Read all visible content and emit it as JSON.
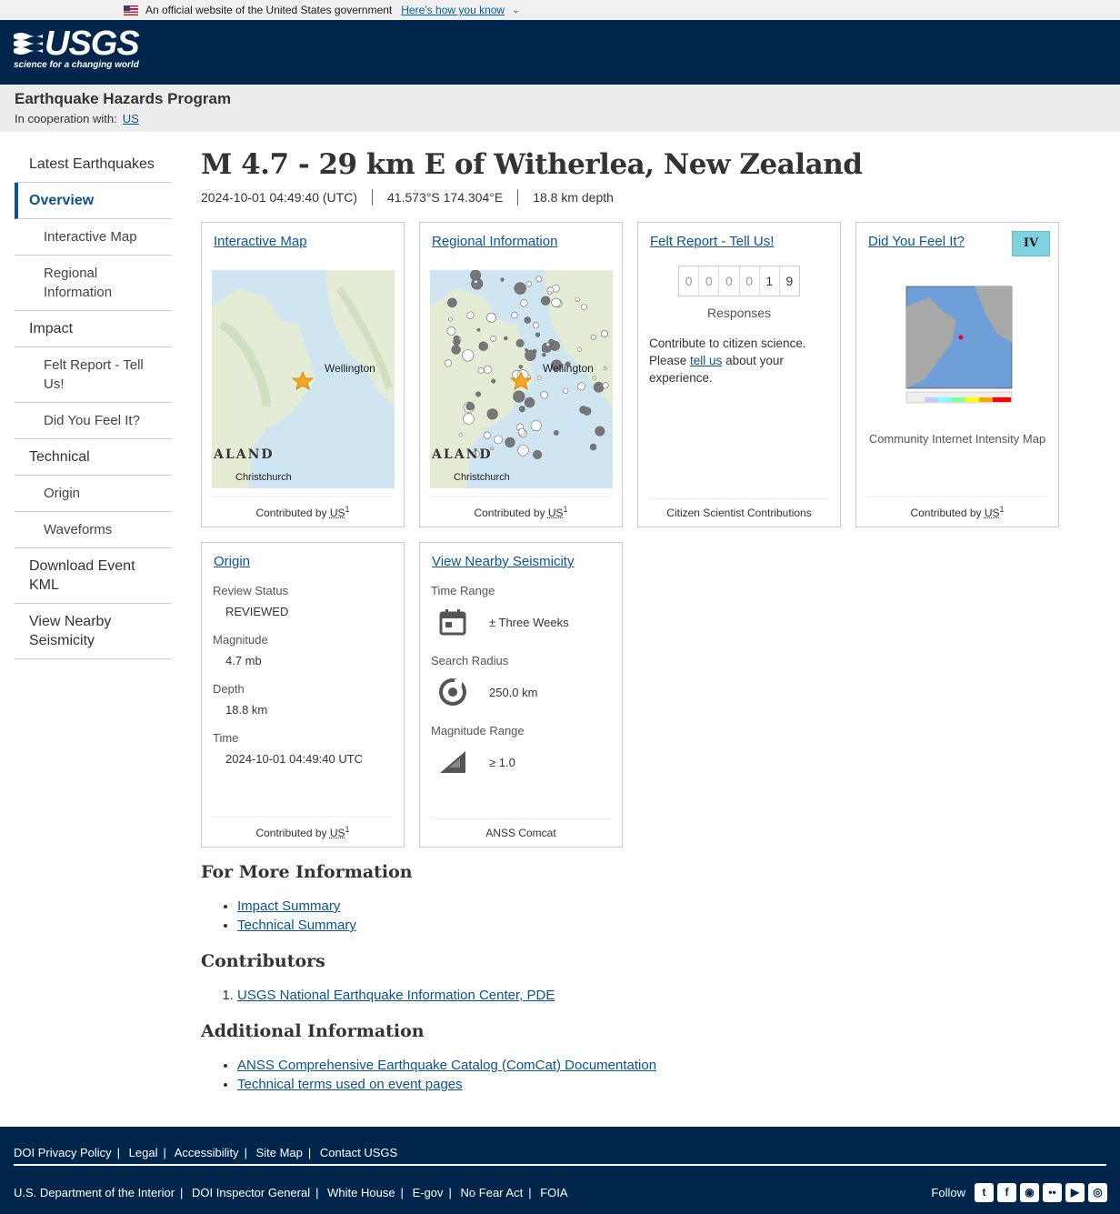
{
  "gov_banner": {
    "text": "An official website of the United States government",
    "link": "Here’s how you know"
  },
  "header": {
    "logo_text": "USGS",
    "logo_tagline": "science for a changing world"
  },
  "site": {
    "title": "Earthquake Hazards Program",
    "coop_label": "In cooperation with:",
    "coop_link": "US"
  },
  "sidebar": {
    "items": [
      {
        "label": "Latest Earthquakes"
      },
      {
        "label": "Overview"
      },
      {
        "label": "Interactive Map"
      },
      {
        "label": "Regional Information"
      },
      {
        "label": "Impact"
      },
      {
        "label": "Felt Report - Tell Us!"
      },
      {
        "label": "Did You Feel It?"
      },
      {
        "label": "Technical"
      },
      {
        "label": "Origin"
      },
      {
        "label": "Waveforms"
      },
      {
        "label": "Download Event KML"
      },
      {
        "label": "View Nearby Seismicity"
      }
    ]
  },
  "event": {
    "title": "M 4.7 - 29 km E of Witherlea, New Zealand",
    "time": "2024-10-01 04:49:40 (UTC)",
    "location": "41.573°S 174.304°E",
    "depth": "18.8 km depth"
  },
  "cards": {
    "interactive_map": {
      "title": "Interactive Map",
      "contributed": "Contributed by",
      "source": "US",
      "ref": "1",
      "place1": "Wellington",
      "place2": "ALAND",
      "place3": "Christchurch"
    },
    "regional": {
      "title": "Regional Information",
      "contributed": "Contributed by",
      "source": "US",
      "ref": "1",
      "place1": "Wellington",
      "place2": "ALAND",
      "place3": "Christchurch"
    },
    "felt": {
      "title": "Felt Report - Tell Us!",
      "digits": [
        "0",
        "0",
        "0",
        "0",
        "1",
        "9"
      ],
      "responses_label": "Responses",
      "text1": "Contribute to citizen science.",
      "text2": "Please",
      "link": "tell us",
      "text3": "about your experience.",
      "footer": "Citizen Scientist Contributions"
    },
    "dyfi": {
      "title": "Did You Feel It?",
      "mmi": "IV",
      "caption": "Community Internet Intensity Map",
      "contributed": "Contributed by",
      "source": "US",
      "ref": "1"
    },
    "origin": {
      "title": "Origin",
      "review_label": "Review Status",
      "review_value": "REVIEWED",
      "mag_label": "Magnitude",
      "mag_value": "4.7 mb",
      "depth_label": "Depth",
      "depth_value": "18.8 km",
      "time_label": "Time",
      "time_value": "2024-10-01 04:49:40 UTC",
      "contributed": "Contributed by",
      "source": "US",
      "ref": "1"
    },
    "seismicity": {
      "title": "View Nearby Seismicity",
      "time_label": "Time Range",
      "time_value": "± Three Weeks",
      "radius_label": "Search Radius",
      "radius_value": "250.0 km",
      "mag_label": "Magnitude Range",
      "mag_value": "≥ 1.0",
      "footer": "ANSS Comcat"
    }
  },
  "info": {
    "more_title": "For More Information",
    "more_links": [
      "Impact Summary",
      "Technical Summary"
    ],
    "contrib_title": "Contributors",
    "contrib_links": [
      "USGS National Earthquake Information Center, PDE"
    ],
    "add_title": "Additional Information",
    "add_links": [
      "ANSS Comprehensive Earthquake Catalog (ComCat) Documentation",
      "Technical terms used on event pages"
    ]
  },
  "footer": {
    "row1": [
      "DOI Privacy Policy",
      "Legal",
      "Accessibility",
      "Site Map",
      "Contact USGS"
    ],
    "row2": [
      "U.S. Department of the Interior",
      "DOI Inspector General",
      "White House",
      "E-gov",
      "No Fear Act",
      "FOIA"
    ],
    "follow": "Follow",
    "social": [
      "twitter-icon",
      "facebook-icon",
      "github-icon",
      "flickr-icon",
      "youtube-icon",
      "instagram-icon"
    ]
  },
  "colors": {
    "navy": "#00264c",
    "link": "#0b5394",
    "mmi_iv": "#7fd3e0"
  }
}
